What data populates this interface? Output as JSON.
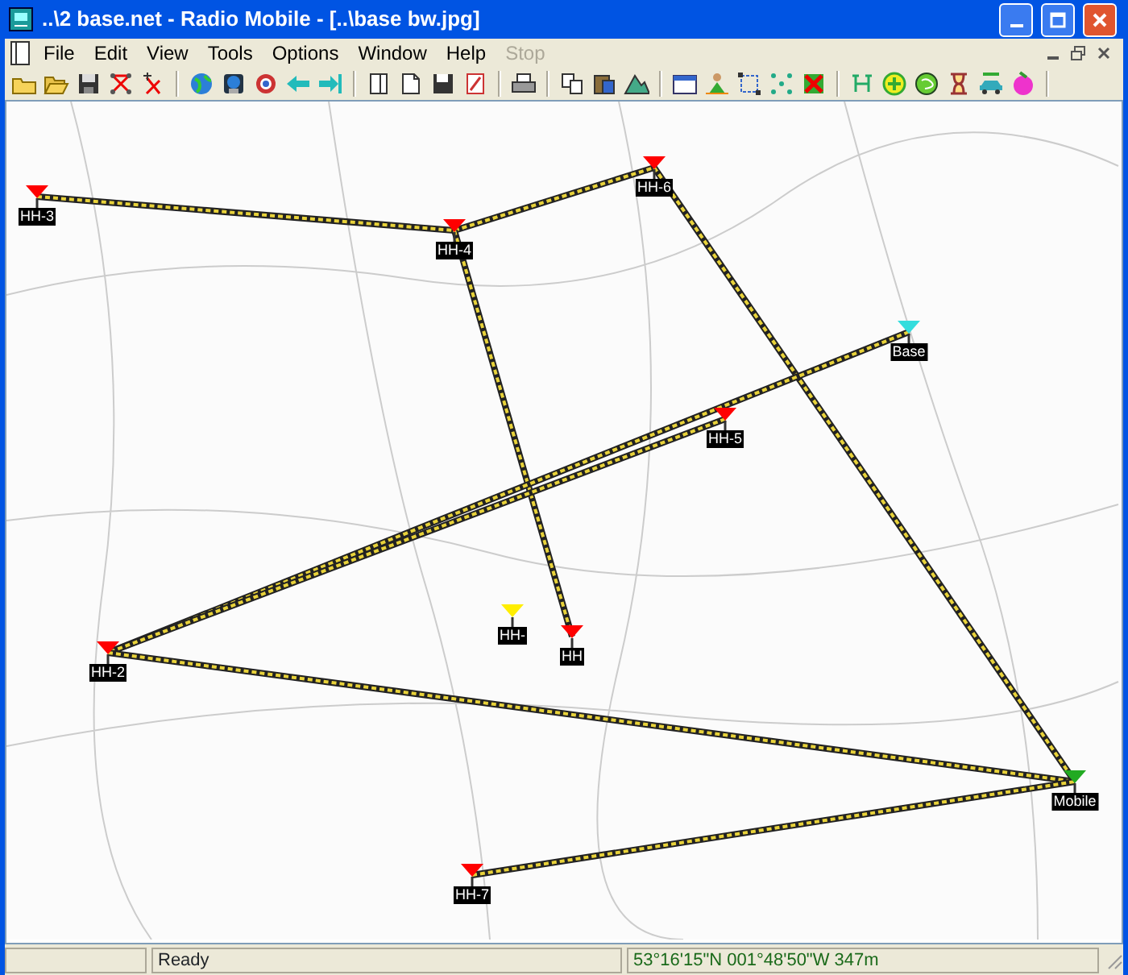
{
  "window": {
    "title": "..\\2 base.net - Radio Mobile - [..\\base bw.jpg]"
  },
  "menu": [
    {
      "label": "File",
      "disabled": false
    },
    {
      "label": "Edit",
      "disabled": false
    },
    {
      "label": "View",
      "disabled": false
    },
    {
      "label": "Tools",
      "disabled": false
    },
    {
      "label": "Options",
      "disabled": false
    },
    {
      "label": "Window",
      "disabled": false
    },
    {
      "label": "Help",
      "disabled": false
    },
    {
      "label": "Stop",
      "disabled": true
    }
  ],
  "nodes": [
    {
      "label": "HH-3",
      "color": "#ff0000"
    },
    {
      "label": "HH-4",
      "color": "#ff0000"
    },
    {
      "label": "HH-6",
      "color": "#ff0000"
    },
    {
      "label": "Base",
      "color": "#33dddd"
    },
    {
      "label": "HH-5",
      "color": "#ff0000"
    },
    {
      "label": "HH-2",
      "color": "#ff0000"
    },
    {
      "label": "HH-",
      "color": "#ffee00"
    },
    {
      "label": "HH",
      "color": "#ff0000"
    },
    {
      "label": "HH-7",
      "color": "#ff0000"
    },
    {
      "label": "Mobile",
      "color": "#22aa22"
    }
  ],
  "status_bar": {
    "message": "Ready",
    "coordinates": "53°16'15\"N 001°48'50\"W 347m"
  }
}
